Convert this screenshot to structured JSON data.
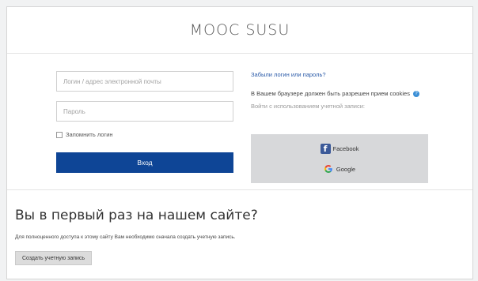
{
  "site": {
    "title": "MOOC SUSU"
  },
  "login": {
    "username_placeholder": "Логин / адрес электронной почты",
    "password_placeholder": "Пароль",
    "remember_label": "Запомнить логин",
    "login_button": "Вход"
  },
  "side": {
    "forgot_link": "Забыли логин или пароль?",
    "cookies_note": "В Вашем браузере должен быть разрешен прием cookies",
    "social_caption": "Войти с использованием учетной записи:",
    "facebook_label": "Facebook",
    "google_label": "Google"
  },
  "first_time": {
    "title": "Вы в первый раз на нашем сайте?",
    "description": "Для полноценного доступа к этому сайту Вам необходимо сначала создать учетную запись.",
    "create_button": "Создать учетную запись"
  },
  "colors": {
    "login_button": "#0e4596",
    "link": "#2a5aa8",
    "social_panel": "#d7d8da",
    "facebook": "#3b5998"
  },
  "icons": {
    "help": "question-circle-icon",
    "facebook": "facebook-f-icon",
    "google": "google-g-icon"
  }
}
